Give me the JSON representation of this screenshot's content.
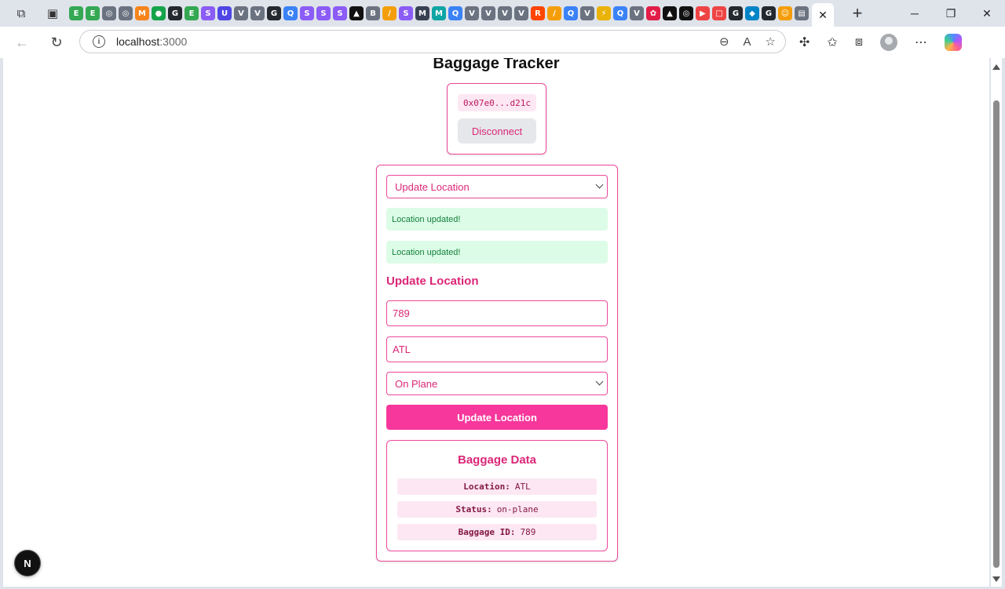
{
  "browser": {
    "url_host": "localhost",
    "url_port": ":3000",
    "tab_favicons": [
      {
        "label": "E",
        "color": "#34a853"
      },
      {
        "label": "E",
        "color": "#34a853"
      },
      {
        "label": "◎",
        "color": "#6b7280"
      },
      {
        "label": "◎",
        "color": "#6b7280"
      },
      {
        "label": "M",
        "color": "#f6851b"
      },
      {
        "label": "●",
        "color": "#16a34a"
      },
      {
        "label": "G",
        "color": "#24292f"
      },
      {
        "label": "E",
        "color": "#34a853"
      },
      {
        "label": "S",
        "color": "#8b5cf6"
      },
      {
        "label": "U",
        "color": "#4f46e5"
      },
      {
        "label": "V",
        "color": "#6b7280"
      },
      {
        "label": "V",
        "color": "#6b7280"
      },
      {
        "label": "G",
        "color": "#24292f"
      },
      {
        "label": "Q",
        "color": "#3b82f6"
      },
      {
        "label": "S",
        "color": "#8b5cf6"
      },
      {
        "label": "S",
        "color": "#8b5cf6"
      },
      {
        "label": "S",
        "color": "#8b5cf6"
      },
      {
        "label": "▲",
        "color": "#111111"
      },
      {
        "label": "B",
        "color": "#6b7280"
      },
      {
        "label": "/",
        "color": "#f59e0b"
      },
      {
        "label": "S",
        "color": "#8b5cf6"
      },
      {
        "label": "M",
        "color": "#374151"
      },
      {
        "label": "M",
        "color": "#0ea5a4"
      },
      {
        "label": "Q",
        "color": "#3b82f6"
      },
      {
        "label": "V",
        "color": "#6b7280"
      },
      {
        "label": "V",
        "color": "#6b7280"
      },
      {
        "label": "V",
        "color": "#6b7280"
      },
      {
        "label": "V",
        "color": "#6b7280"
      },
      {
        "label": "R",
        "color": "#ff4500"
      },
      {
        "label": "/",
        "color": "#f59e0b"
      },
      {
        "label": "Q",
        "color": "#3b82f6"
      },
      {
        "label": "V",
        "color": "#6b7280"
      },
      {
        "label": "⚡",
        "color": "#eab308"
      },
      {
        "label": "Q",
        "color": "#3b82f6"
      },
      {
        "label": "V",
        "color": "#6b7280"
      },
      {
        "label": "✿",
        "color": "#e11d48"
      },
      {
        "label": "▲",
        "color": "#111111"
      },
      {
        "label": "◎",
        "color": "#111111"
      },
      {
        "label": "▶",
        "color": "#ef4444"
      },
      {
        "label": "□",
        "color": "#ef4444"
      },
      {
        "label": "G",
        "color": "#24292f"
      },
      {
        "label": "◆",
        "color": "#0284c7"
      },
      {
        "label": "G",
        "color": "#24292f"
      },
      {
        "label": "☺",
        "color": "#f59e0b"
      },
      {
        "label": "▤",
        "color": "#6b7280"
      }
    ]
  },
  "page": {
    "title": "Baggage Tracker",
    "wallet_address": "0x07e0...d21c",
    "disconnect_label": "Disconnect",
    "action_select": "Update Location",
    "alerts": [
      "Location updated!",
      "Location updated!"
    ],
    "section_title": "Update Location",
    "baggage_id_input": "789",
    "location_input": "ATL",
    "status_select": "On Plane",
    "submit_label": "Update Location",
    "data_title": "Baggage Data",
    "data_rows": [
      {
        "key": "Location:",
        "value": "ATL"
      },
      {
        "key": "Status:",
        "value": "on-plane"
      },
      {
        "key": "Baggage ID:",
        "value": "789"
      }
    ],
    "next_badge": "N"
  },
  "colors": {
    "accent": "#ec4899",
    "button": "#f7379b",
    "success_bg": "#dcfce7",
    "success_text": "#15803d"
  }
}
